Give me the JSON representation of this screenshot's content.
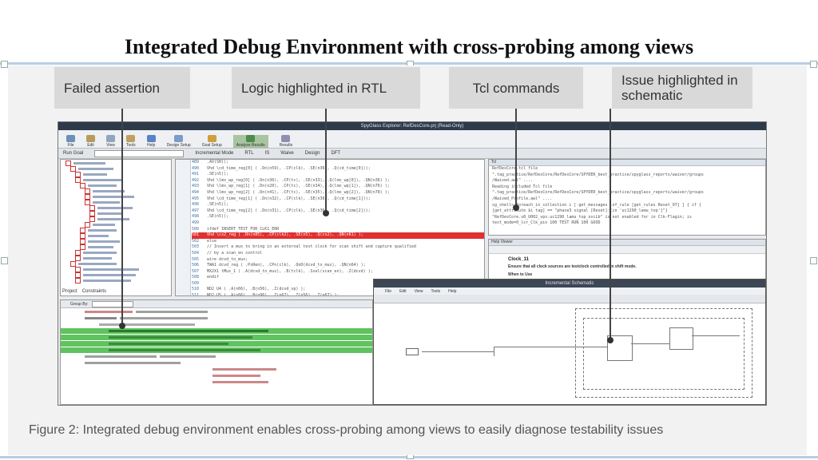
{
  "slide": {
    "title": "Integrated Debug Environment  with cross-probing among views"
  },
  "callouts": {
    "failed_assertion": "Failed assertion",
    "rtl": "Logic highlighted in RTL",
    "tcl": "Tcl commands",
    "schematic": "Issue highlighted in schematic"
  },
  "caption": "Figure 2: Integrated debug environment enables cross-probing among views to easily diagnose testability issues",
  "app": {
    "window_title": "SpyGlass Explorer: RefDesCore.prj (Read-Only)",
    "toolbar": [
      "File",
      "Edit",
      "View",
      "Tools",
      "Help",
      "Design Setup",
      "Goal Setup",
      "Analyze Results",
      "Results"
    ],
    "run_goal_label": "Run Goal",
    "incremental_mode": "Incremental Mode",
    "view_buttons": [
      "RTL",
      "IS",
      "Waive",
      "Design",
      "DFT"
    ],
    "group_by_label": "Group By:",
    "help_title": "Clock_11",
    "help_rule": "Ensure that all clock sources are testclock controlled in shift mode.",
    "help_when": "When to Use",
    "schematic_title": "Incremental Schematic",
    "schematic_menu": [
      "File",
      "Edit",
      "View",
      "Tools",
      "Help"
    ],
    "tabs": [
      "Project",
      "Constraints"
    ]
  },
  "colors": {
    "highlight_red": "#e03030",
    "highlight_green": "#5fc35f",
    "frame_blue": "#b9cde4",
    "callout_bg": "#d9d9d9"
  }
}
